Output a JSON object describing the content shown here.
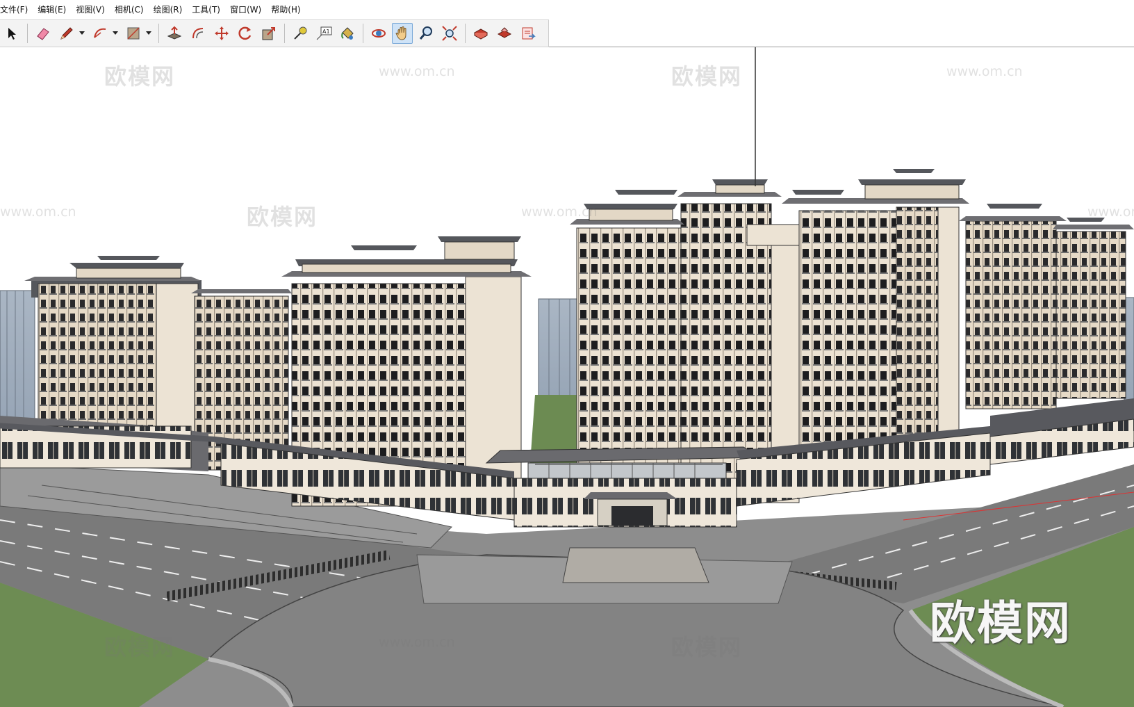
{
  "menu": [
    {
      "label": "文件(F)"
    },
    {
      "label": "编辑(E)"
    },
    {
      "label": "视图(V)"
    },
    {
      "label": "相机(C)"
    },
    {
      "label": "绘图(R)"
    },
    {
      "label": "工具(T)"
    },
    {
      "label": "窗口(W)"
    },
    {
      "label": "帮助(H)"
    }
  ],
  "toolbar": {
    "tools": [
      {
        "icon": "select-arrow-icon"
      },
      {
        "icon": "eraser-icon"
      },
      {
        "icon": "pencil-icon",
        "dropdown": true
      },
      {
        "icon": "arc-icon",
        "dropdown": true
      },
      {
        "icon": "rectangle-icon",
        "dropdown": true
      },
      {
        "icon": "push-pull-icon"
      },
      {
        "icon": "offset-icon"
      },
      {
        "icon": "move-icon"
      },
      {
        "icon": "rotate-icon"
      },
      {
        "icon": "scale-icon"
      },
      {
        "icon": "tape-measure-icon"
      },
      {
        "icon": "text-label-icon",
        "text": "A1"
      },
      {
        "icon": "paint-bucket-icon"
      },
      {
        "icon": "orbit-icon"
      },
      {
        "icon": "pan-hand-icon",
        "active": true
      },
      {
        "icon": "zoom-icon"
      },
      {
        "icon": "zoom-extents-icon"
      },
      {
        "icon": "warehouse-icon"
      },
      {
        "icon": "share-model-icon"
      },
      {
        "icon": "layout-icon"
      }
    ]
  },
  "watermarks": {
    "cn": "欧模网",
    "url": "www.om.cn",
    "big": "欧模网"
  },
  "colors": {
    "sky": "#ffffff",
    "facade": "#ece2d2",
    "roof": "#6e6e72",
    "road": "#858585",
    "grass": "#6f8d55",
    "active_tool": "#cfe3f7"
  }
}
